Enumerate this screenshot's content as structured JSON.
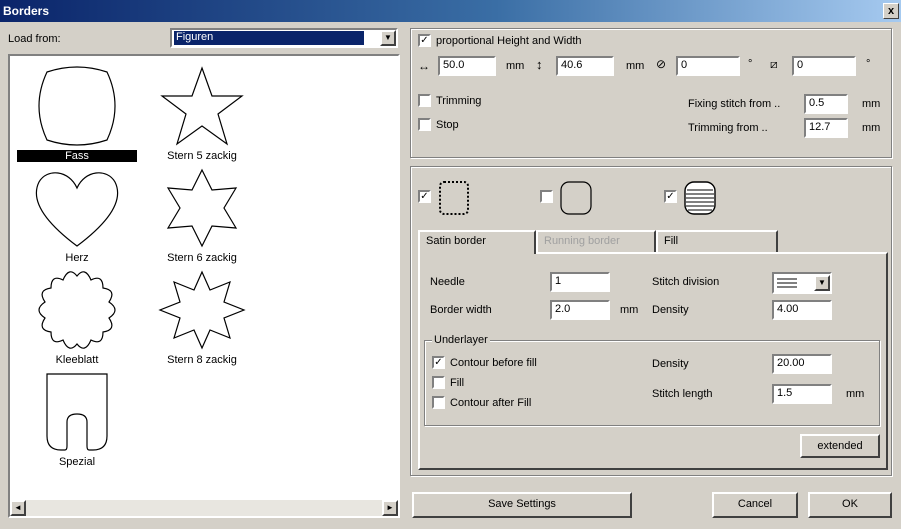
{
  "window": {
    "title": "Borders",
    "close_glyph": "x"
  },
  "left": {
    "load_from_label": "Load from:",
    "load_from_value": "Figuren",
    "shapes": [
      {
        "name": "Fass",
        "selected": true
      },
      {
        "name": "Stern 5 zackig",
        "selected": false
      },
      {
        "name": "Herz",
        "selected": false
      },
      {
        "name": "Stern 6 zackig",
        "selected": false
      },
      {
        "name": "Kleeblatt",
        "selected": false
      },
      {
        "name": "Stern 8 zackig",
        "selected": false
      },
      {
        "name": "Spezial",
        "selected": false
      }
    ],
    "scroll_left": "◄",
    "scroll_right": "►"
  },
  "settings": {
    "proportional_label": "proportional Height and Width",
    "proportional_checked": true,
    "width_value": "50.0",
    "width_unit": "mm",
    "height_value": "40.6",
    "height_unit": "mm",
    "angle1_value": "0",
    "angle1_unit": "°",
    "angle2_value": "0",
    "angle2_unit": "°",
    "trimming_label": "Trimming",
    "trimming_checked": false,
    "stop_label": "Stop",
    "stop_checked": false,
    "fixing_label": "Fixing stitch from ..",
    "fixing_value": "0.5",
    "fixing_unit": "mm",
    "trimming_from_label": "Trimming from ..",
    "trimming_from_value": "12.7",
    "trimming_from_unit": "mm"
  },
  "types": {
    "satin_checked": true,
    "running_checked": false,
    "fill_checked": true
  },
  "tabs": [
    {
      "label": "Satin border",
      "active": true,
      "disabled": false
    },
    {
      "label": "Running border",
      "active": false,
      "disabled": true
    },
    {
      "label": "Fill",
      "active": false,
      "disabled": false
    }
  ],
  "satin": {
    "needle_label": "Needle",
    "needle_value": "1",
    "border_width_label": "Border width",
    "border_width_value": "2.0",
    "border_width_unit": "mm",
    "stitch_division_label": "Stitch division",
    "density_label": "Density",
    "density_value": "4.00"
  },
  "underlayer": {
    "legend": "Underlayer",
    "contour_before_fill_label": "Contour before fill",
    "contour_before_fill_checked": true,
    "fill_label": "Fill",
    "fill_checked": false,
    "contour_after_fill_label": "Contour after Fill",
    "contour_after_fill_checked": false,
    "density_label": "Density",
    "density_value": "20.00",
    "stitch_length_label": "Stitch length",
    "stitch_length_value": "1.5",
    "stitch_length_unit": "mm"
  },
  "buttons": {
    "extended": "extended",
    "save_settings": "Save Settings",
    "cancel": "Cancel",
    "ok": "OK"
  },
  "checkmark": "✓"
}
